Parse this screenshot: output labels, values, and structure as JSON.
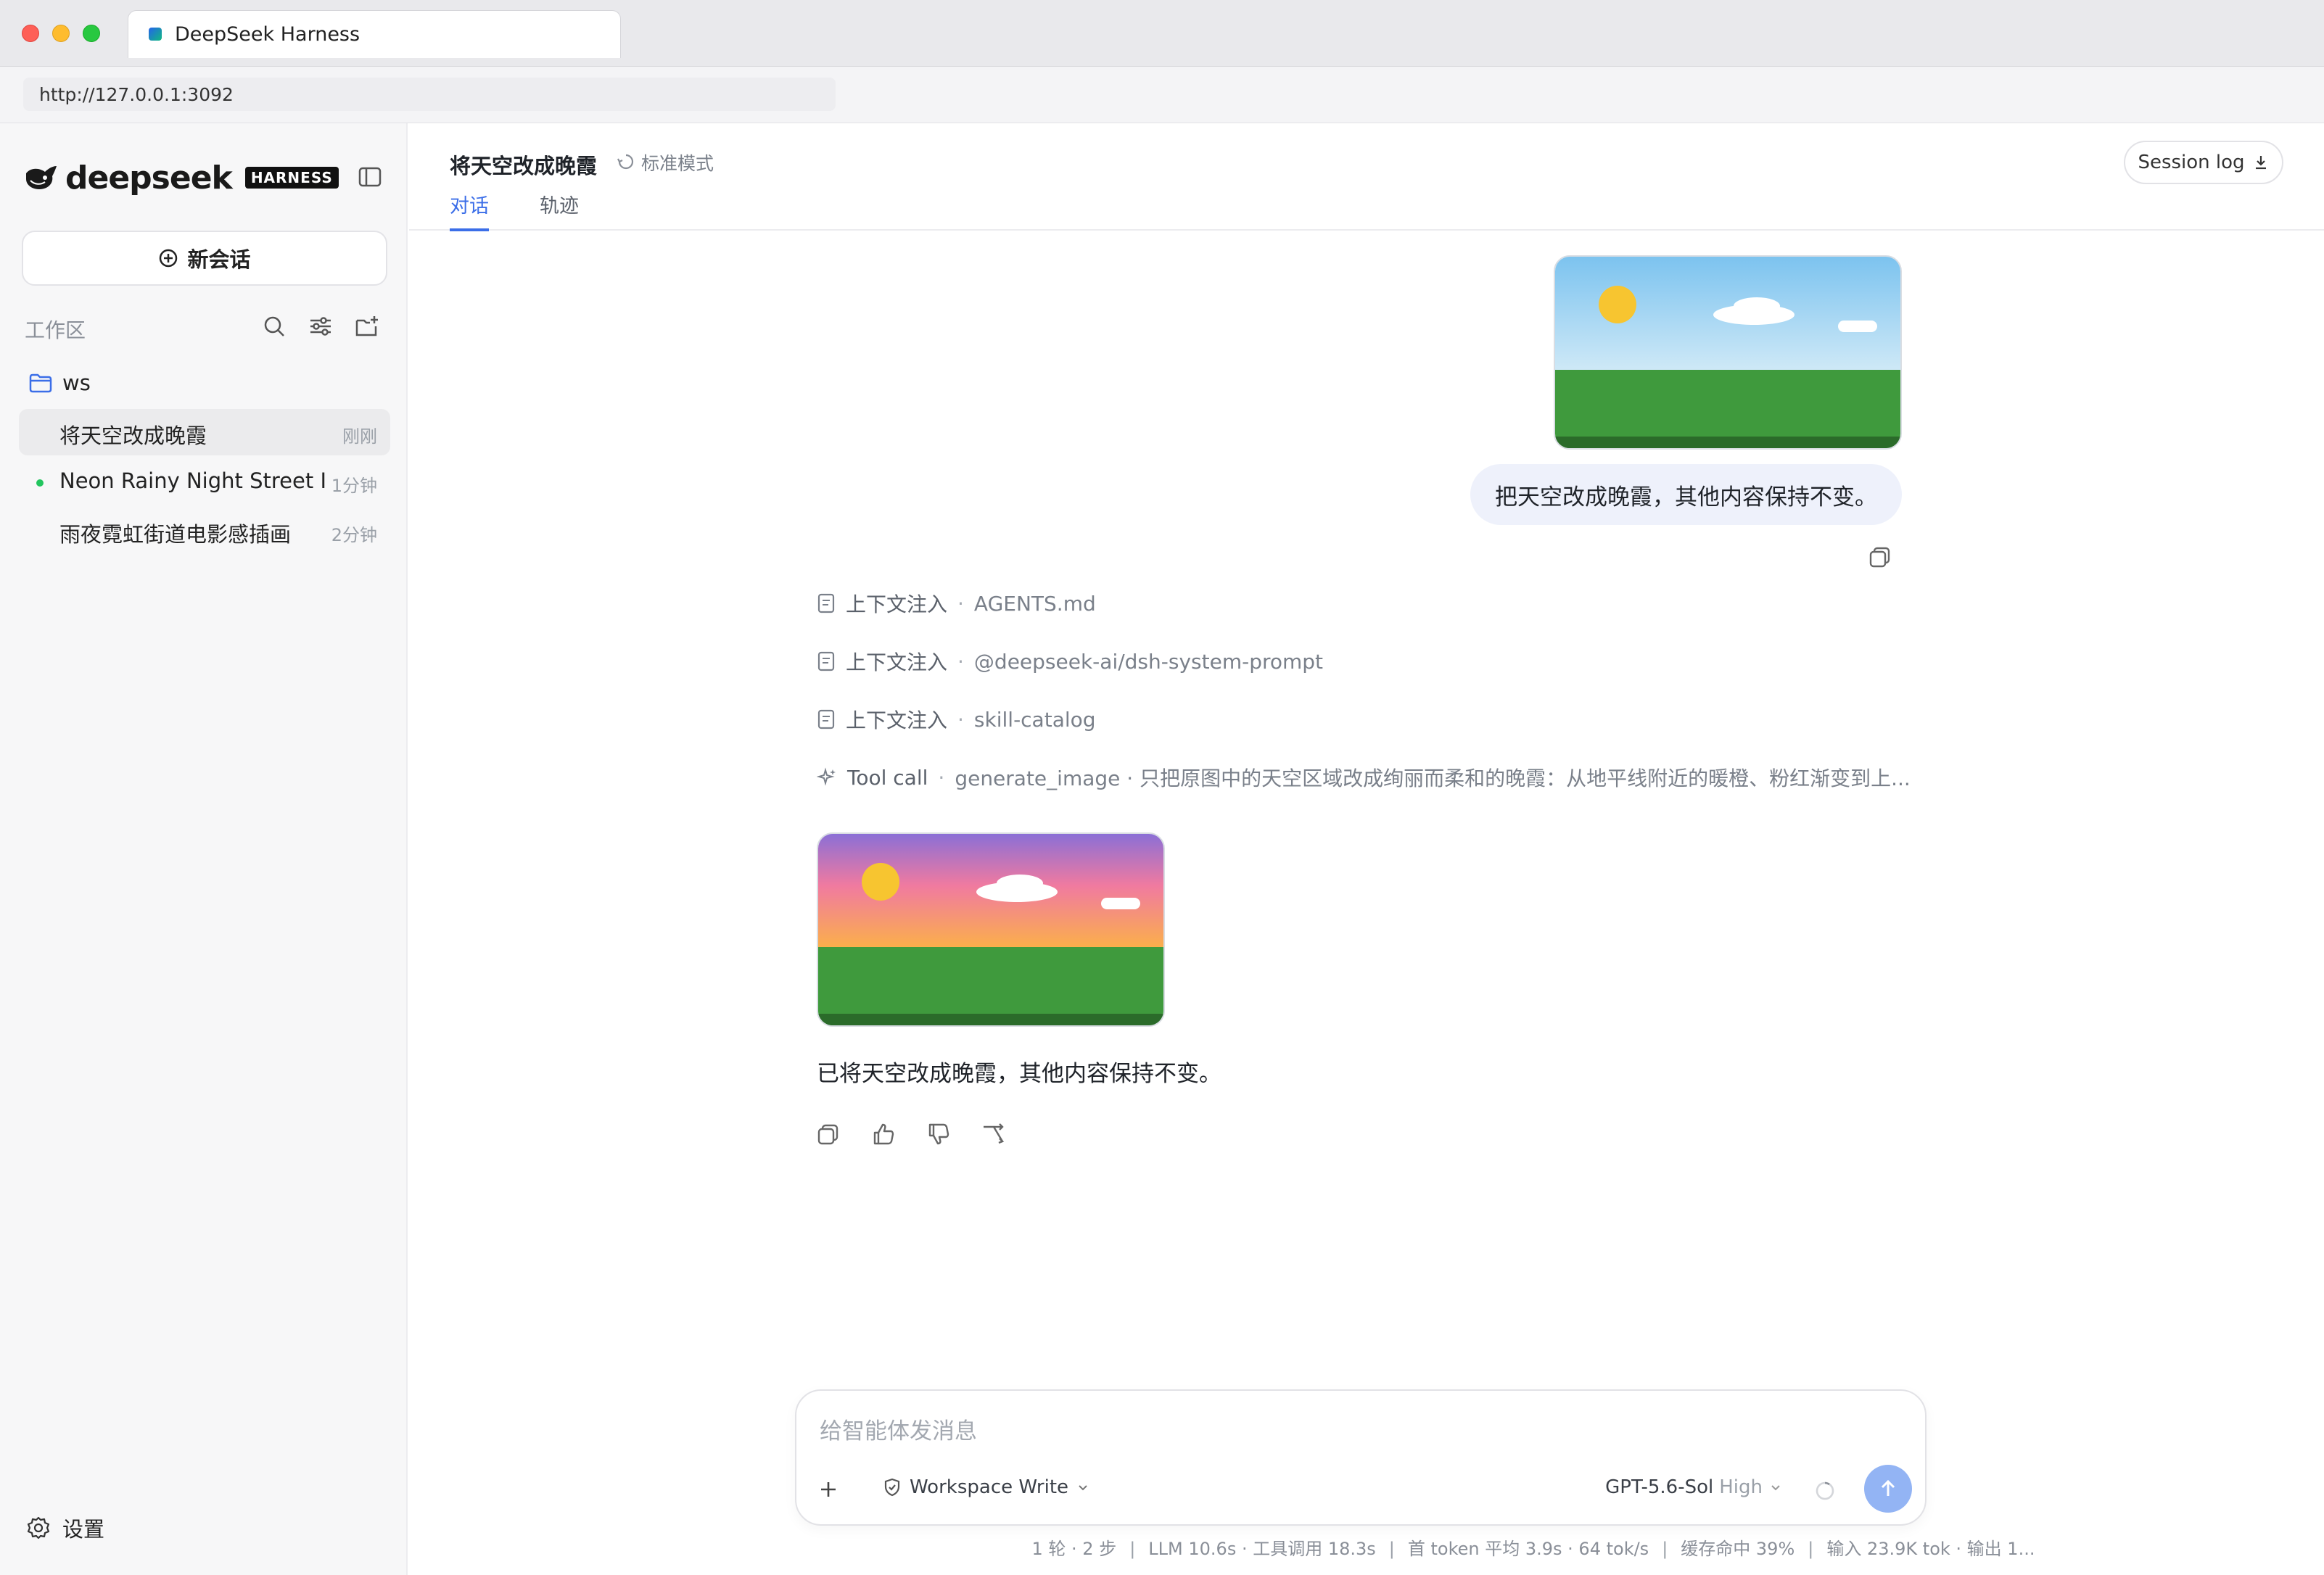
{
  "browser": {
    "tab_title": "DeepSeek Harness",
    "url": "http://127.0.0.1:3092"
  },
  "sidebar": {
    "logo_text": "deepseek",
    "logo_badge": "HARNESS",
    "new_chat_label": "新会话",
    "workspace_label": "工作区",
    "folder_name": "ws",
    "sessions": [
      {
        "name": "将天空改成晚霞",
        "time": "刚刚",
        "active": true,
        "running": false
      },
      {
        "name": "Neon Rainy Night Street Ill...",
        "time": "1分钟",
        "active": false,
        "running": true
      },
      {
        "name": "雨夜霓虹街道电影感插画",
        "time": "2分钟",
        "active": false,
        "running": false
      }
    ],
    "settings_label": "设置"
  },
  "header": {
    "title": "将天空改成晚霞",
    "mode": "标准模式",
    "tabs": [
      "对话",
      "轨迹"
    ],
    "active_tab": "对话",
    "session_log_label": "Session log"
  },
  "conversation": {
    "user_message": "把天空改成晚霞，其他内容保持不变。",
    "trace": [
      {
        "kind": "上下文注入",
        "value": "AGENTS.md",
        "icon": "document-icon"
      },
      {
        "kind": "上下文注入",
        "value": "@deepseek-ai/dsh-system-prompt",
        "icon": "document-icon"
      },
      {
        "kind": "上下文注入",
        "value": "skill-catalog",
        "icon": "document-icon"
      },
      {
        "kind": "Tool call",
        "value": "generate_image · 只把原图中的天空区域改成绚丽而柔和的晚霞：从地平线附近的暖橙、粉红渐变到上...",
        "icon": "sparkle-icon"
      }
    ],
    "assistant_reply": "已将天空改成晚霞，其他内容保持不变。"
  },
  "composer": {
    "placeholder": "给智能体发消息",
    "permission": "Workspace Write",
    "model": "GPT-5.6-Sol",
    "effort": "High"
  },
  "status": {
    "rounds": "1 轮 · 2 步",
    "timing": "LLM 10.6s · 工具调用 18.3s",
    "first_token": "首 token 平均 3.9s · 64 tok/s",
    "cache": "缓存命中 39%",
    "tokens": "输入 23.9K tok · 输出 1..."
  },
  "colors": {
    "accent": "#3b6ee8",
    "send_button": "#93b4f4",
    "user_bubble": "#eef1fb",
    "running_dot": "#22c55e"
  }
}
